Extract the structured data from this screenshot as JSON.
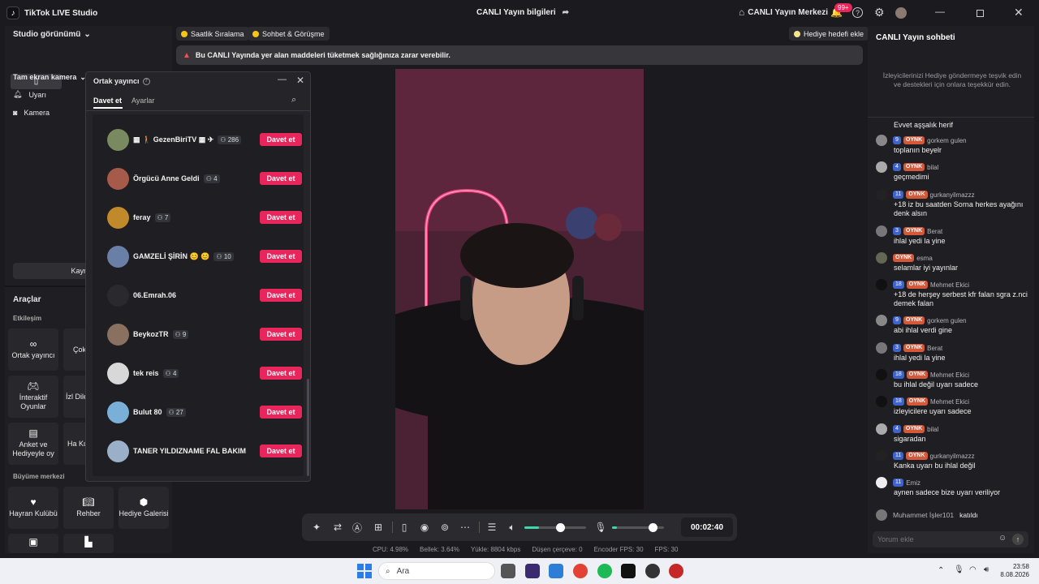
{
  "titlebar": {
    "app_name": "TikTok LIVE Studio",
    "center_title": "CANLI Yayın bilgileri",
    "live_center": "CANLI Yayın Merkezi",
    "notification_count": "99+"
  },
  "left": {
    "studio_view": "Studio görünümü",
    "source_title": "Tam ekran kamera",
    "sources": [
      "Uyarı",
      "Kamera"
    ],
    "add_source_partial": "Kayn",
    "tools_title": "Araçlar",
    "section_engagement": "Etkileşim",
    "tools_engagement": [
      "Ortak yayıncı",
      "Çokl",
      "İnteraktif Oyunlar",
      "İzl Dile",
      "Anket ve Hediyeyle oy",
      "Ha Ku"
    ],
    "section_growth": "Büyüme merkezi",
    "tools_growth": [
      "Hayran Kulübü",
      "Rehber",
      "Hediye Galerisi"
    ]
  },
  "chips": {
    "hourly": "Saatlik Sıralama",
    "chat_call": "Sohbet & Görüşme",
    "gift_goal": "Hediye hedefi ekle"
  },
  "warning": "Bu CANLI Yayında yer alan maddeleri tüketmek sağlığınıza zarar verebilir.",
  "panel": {
    "title": "Ortak yayıncı",
    "tabs": [
      "Davet et",
      "Ayarlar"
    ],
    "invite_label": "Davet et",
    "users": [
      {
        "name": "▦ 🚶 GezenBiriTV ▦ ✈",
        "count": "286"
      },
      {
        "name": "Örgücü Anne Geldi",
        "count": "4"
      },
      {
        "name": "feray",
        "count": "7"
      },
      {
        "name": "GAMZELİ ŞİRİN 😊 😊",
        "count": "10"
      },
      {
        "name": "06.Emrah.06",
        "count": ""
      },
      {
        "name": "BeykozTR",
        "count": "9"
      },
      {
        "name": "tek reis",
        "count": "4"
      },
      {
        "name": "Bulut 80",
        "count": "27"
      },
      {
        "name": "TANER YILDIZNAME FAL BAKIM",
        "count": ""
      }
    ]
  },
  "controls": {
    "timer": "00:02:40",
    "volume_level": 0.58,
    "mic_level": 0.78
  },
  "stats": {
    "cpu": "CPU:  4.98%",
    "memory": "Bellek:  3.64%",
    "upload": "Yükle:  8804 kbps",
    "dropped": "Düşen çerçeve:  0",
    "encoder_fps": "Encoder FPS:  30",
    "fps": "FPS:  30"
  },
  "chat": {
    "title": "CANLI Yayın sohbeti",
    "hint": "İzleyicilerinizi Hediye göndermeye teşvik edin ve destekleri için onlara teşekkür edin.",
    "first_text": "Evvet aşşalık herif",
    "messages": [
      {
        "level": "9",
        "fan": "OYNK",
        "user": "gorkem gulen",
        "text": "toplanın beyelr"
      },
      {
        "level": "4",
        "fan": "OYNK",
        "user": "bilal",
        "text": "geçmedimi"
      },
      {
        "level": "11",
        "fan": "OYNK",
        "user": "gurkanyilmazzz",
        "text": "+18 iz bu saatden Sorna herkes ayağını denk alsın"
      },
      {
        "level": "3",
        "fan": "OYNK",
        "user": "Berat",
        "text": "ihlal yedi la yine"
      },
      {
        "level": "",
        "fan": "OYNK",
        "user": "esma",
        "text": "selamlar iyi yayınlar"
      },
      {
        "level": "18",
        "fan": "OYNK",
        "user": "Mehmet Ekici",
        "text": "+18 de herşey serbest kfr falan sgra z.nci demek falan"
      },
      {
        "level": "9",
        "fan": "OYNK",
        "user": "gorkem gulen",
        "text": "abi ihlal verdi gine"
      },
      {
        "level": "3",
        "fan": "OYNK",
        "user": "Berat",
        "text": "ihlal yedi la yine"
      },
      {
        "level": "18",
        "fan": "OYNK",
        "user": "Mehmet Ekici",
        "text": "bu ihlal değil uyarı sadece"
      },
      {
        "level": "18",
        "fan": "OYNK",
        "user": "Mehmet Ekici",
        "text": "izleyicilere uyarı sadece"
      },
      {
        "level": "4",
        "fan": "OYNK",
        "user": "bilal",
        "text": "sigaradan"
      },
      {
        "level": "11",
        "fan": "OYNK",
        "user": "gurkanyilmazzz",
        "text": "Kanka uyarı bu ihlal değil"
      },
      {
        "level": "11",
        "fan": "",
        "user": "Emiz",
        "text": "aynen sadece bize uyarı veriliyor"
      }
    ],
    "join_user": "Muhammet İşler101",
    "join_text": "katıldı",
    "input_placeholder": "Yorum ekle"
  },
  "taskbar": {
    "search_placeholder": "Ara",
    "time": "23:58",
    "date": "8.08.2026"
  },
  "colors": {
    "accent": "#e8265b",
    "level_badge": "#3f63c9",
    "fan_badge": "#d4583a"
  }
}
